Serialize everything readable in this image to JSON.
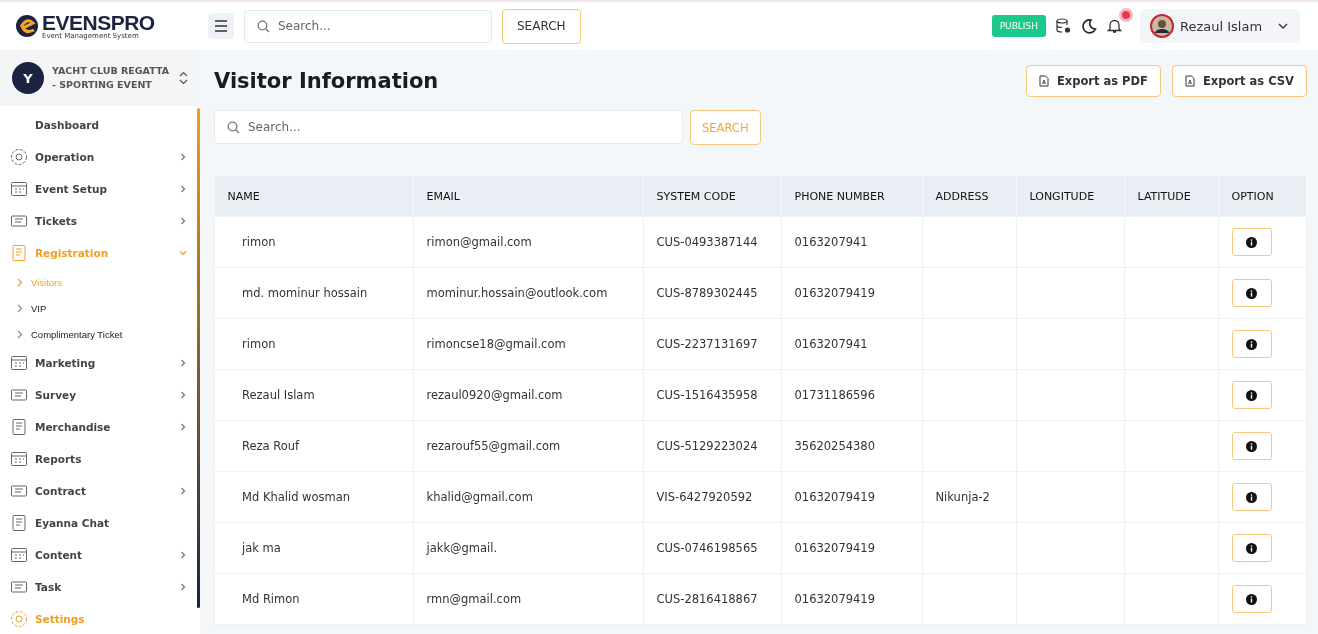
{
  "brand": {
    "name": "EVENSPRO",
    "tagline": "Event Management System"
  },
  "topbar": {
    "search": {
      "placeholder": "Search..."
    },
    "search_button": "SEARCH",
    "publish_button": "PUBLISH",
    "notification_unread": true,
    "user": {
      "name": "Rezaul Islam"
    }
  },
  "event_switcher": {
    "initial": "Y",
    "name": "YACHT CLUB REGATTA - SPORTING EVENT"
  },
  "sidebar": {
    "items": [
      {
        "label": "Dashboard",
        "expandable": false,
        "expanded": false,
        "selected": false
      },
      {
        "label": "Operation",
        "expandable": true,
        "expanded": false,
        "selected": false
      },
      {
        "label": "Event Setup",
        "expandable": true,
        "expanded": false,
        "selected": false
      },
      {
        "label": "Tickets",
        "expandable": true,
        "expanded": false,
        "selected": false
      },
      {
        "label": "Registration",
        "expandable": true,
        "expanded": true,
        "selected": true,
        "children": [
          {
            "label": "Visitors",
            "selected": true
          },
          {
            "label": "VIP",
            "selected": false
          },
          {
            "label": "Complimentary Ticket",
            "selected": false
          }
        ]
      },
      {
        "label": "Marketing",
        "expandable": true,
        "expanded": false,
        "selected": false
      },
      {
        "label": "Survey",
        "expandable": true,
        "expanded": false,
        "selected": false
      },
      {
        "label": "Merchandise",
        "expandable": true,
        "expanded": false,
        "selected": false
      },
      {
        "label": "Reports",
        "expandable": false,
        "expanded": false,
        "selected": false
      },
      {
        "label": "Contract",
        "expandable": true,
        "expanded": false,
        "selected": false
      },
      {
        "label": "Eyanna Chat",
        "expandable": false,
        "expanded": false,
        "selected": false
      },
      {
        "label": "Content",
        "expandable": true,
        "expanded": false,
        "selected": false
      },
      {
        "label": "Task",
        "expandable": true,
        "expanded": false,
        "selected": false
      },
      {
        "label": "Settings",
        "expandable": false,
        "expanded": false,
        "selected": true
      }
    ]
  },
  "page": {
    "title": "Visitor Information",
    "export_buttons": [
      "Export as PDF",
      "Export as CSV"
    ],
    "search": {
      "placeholder": "Search..."
    },
    "search_button": "SEARCH"
  },
  "table": {
    "columns": [
      "NAME",
      "EMAIL",
      "SYSTEM CODE",
      "PHONE NUMBER",
      "ADDRESS",
      "LONGITUDE",
      "LATITUDE",
      "OPTION"
    ],
    "rows": [
      [
        "rimon",
        "rimon@gmail.com",
        "CUS-0493387144",
        "0163207941",
        "",
        "",
        ""
      ],
      [
        "md. mominur hossain",
        "mominur.hossain@outlook.com",
        "CUS-8789302445",
        "01632079419",
        "",
        "",
        ""
      ],
      [
        "rimon",
        "rimoncse18@gmail.com",
        "CUS-2237131697",
        "0163207941",
        "",
        "",
        ""
      ],
      [
        "Rezaul Islam",
        "rezaul0920@gmail.com",
        "CUS-1516435958",
        "01731186596",
        "",
        "",
        ""
      ],
      [
        "Reza Rouf",
        "rezarouf55@gmail.com",
        "CUS-5129223024",
        "35620254380",
        "",
        "",
        ""
      ],
      [
        "Md Khalid wosman",
        "khalid@gmail.com",
        "VIS-6427920592",
        "01632079419",
        "Nikunja-2",
        "",
        ""
      ],
      [
        "jak ma",
        "jakk@gmail.",
        "CUS-0746198565",
        "01632079419",
        "",
        "",
        ""
      ],
      [
        "Md Rimon",
        "rmn@gmail.com",
        "CUS-2816418867",
        "01632079419",
        "",
        "",
        ""
      ]
    ]
  }
}
